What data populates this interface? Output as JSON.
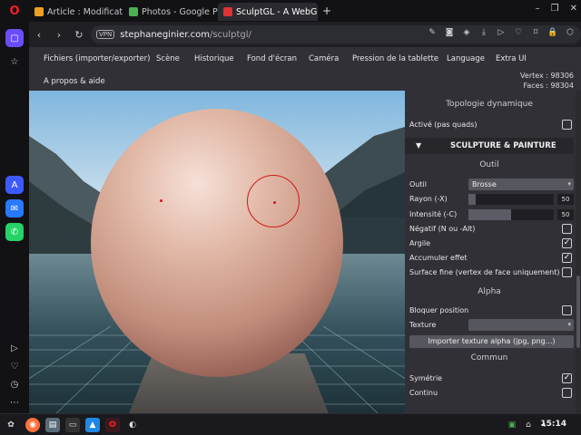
{
  "tabs": [
    {
      "title": "Article : Modification",
      "favicon_color": "#f0a020"
    },
    {
      "title": "Photos - Google Pho",
      "favicon_color": "#4caf50"
    },
    {
      "title": "SculptGL - A WebGL",
      "favicon_color": "#d33",
      "active": true
    }
  ],
  "icons": {
    "browser_logo": "opera-logo-icon",
    "new_tab": "+",
    "close_tab": "✕",
    "back": "‹",
    "forward": "›",
    "reload": "↻",
    "vpn": "VPN",
    "minimize": "–",
    "restore": "❐",
    "close": "✕"
  },
  "address": {
    "host": "stephaneginier.com",
    "path": "/sculptgl/"
  },
  "menu": [
    "Fichiers (importer/exporter)",
    "Scène",
    "Historique",
    "Fond d'écran",
    "Caméra",
    "Pression de la tablette",
    "Language",
    "Extra UI",
    "A propos & aide"
  ],
  "stats": {
    "vertex": "Vertex : 98306",
    "faces": "Faces : 98304"
  },
  "panel": {
    "topo_title": "Topologie dynamique",
    "topo_active_label": "Activé (pas quads)",
    "topo_active": false,
    "sculpt_header": "SCULPTURE & PAINTURE",
    "sculpt_arrow": "▼",
    "outil_title": "Outil",
    "outil_label": "Outil",
    "outil_value": "Brosse",
    "rayon_label": "Rayon (-X)",
    "rayon_value": "50",
    "rayon_fraction": 0.08,
    "intensite_label": "Intensité (-C)",
    "intensite_value": "50",
    "intensite_fraction": 0.5,
    "negatif_label": "Négatif (N ou -Alt)",
    "negatif": false,
    "argile_label": "Argile",
    "argile": true,
    "accumuler_label": "Accumuler effet",
    "accumuler": true,
    "surface_label": "Surface fine (vertex de face uniquement)",
    "surface": false,
    "alpha_title": "Alpha",
    "bloquer_label": "Bloquer position",
    "bloquer": false,
    "texture_label": "Texture",
    "texture_value": "",
    "import_btn": "Importer texture alpha (jpg, png...)",
    "commun_title": "Commun",
    "symetrie_label": "Symétrie",
    "symetrie": true,
    "continu_label": "Continu",
    "continu": false,
    "check_glyph": "✓"
  },
  "taskbar": {
    "clock": "15:14"
  },
  "colors": {
    "accent": "#6b4cff",
    "brush": "#d01a1a",
    "opera_red": "#ff1b2d"
  }
}
